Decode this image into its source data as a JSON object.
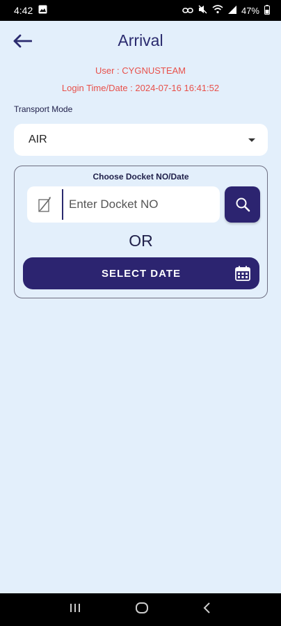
{
  "status_bar": {
    "time": "4:42",
    "battery": "47%",
    "icons": [
      "gallery-icon",
      "link-icon",
      "mute-icon",
      "wifi-icon",
      "signal-icon",
      "battery-icon"
    ]
  },
  "header": {
    "title": "Arrival",
    "back_icon": "arrow-left-icon"
  },
  "session": {
    "user": "User : CYGNUSTEAM",
    "login": "Login Time/Date : 2024-07-16 16:41:52"
  },
  "transport": {
    "label": "Transport Mode",
    "selected": "AIR"
  },
  "docket": {
    "title": "Choose Docket NO/Date",
    "placeholder": "Enter Docket NO",
    "or_text": "OR",
    "select_date_label": "SELECT DATE"
  },
  "colors": {
    "background": "#e3effb",
    "primary": "#2c2470",
    "accent_text": "#e8504a"
  }
}
